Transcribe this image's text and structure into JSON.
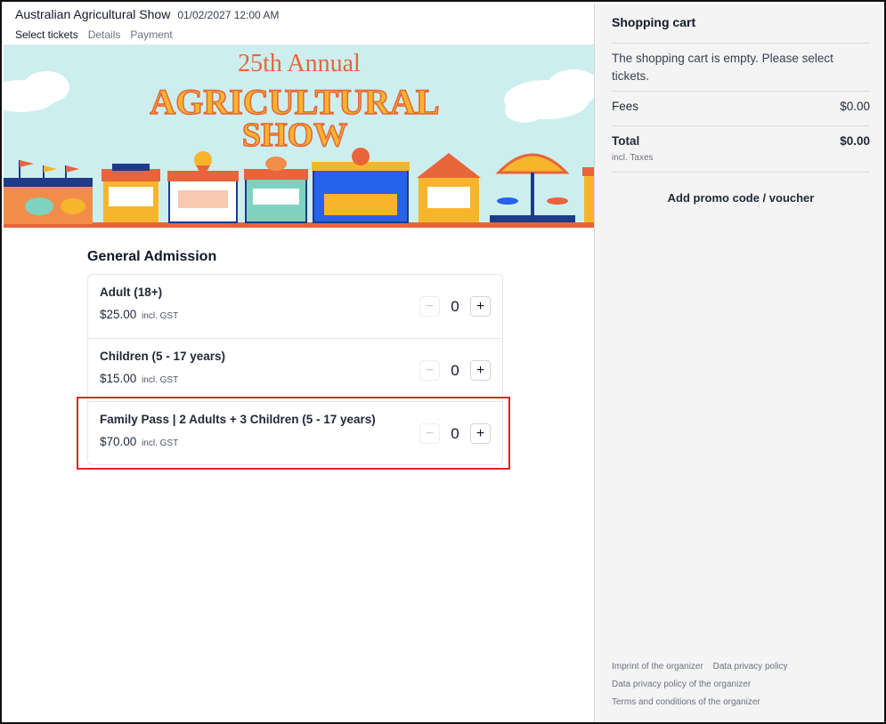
{
  "event": {
    "title": "Australian Agricultural Show",
    "date": "01/02/2027 12:00 AM"
  },
  "steps": [
    "Select tickets",
    "Details",
    "Payment"
  ],
  "banner": {
    "line1": "25th Annual",
    "line2": "AGRICULTURAL",
    "line3": "SHOW",
    "colors": {
      "sky": "#cdeeee",
      "orange": "#e8643a",
      "yellow": "#f7b52c",
      "navy": "#1e3a8a"
    }
  },
  "admission": {
    "title": "General Admission",
    "tickets": [
      {
        "name": "Adult (18+)",
        "price": "$25.00",
        "tax": "incl. GST",
        "qty": "0",
        "minus": "−",
        "plus": "+"
      },
      {
        "name": "Children (5 - 17 years)",
        "price": "$15.00",
        "tax": "incl. GST",
        "qty": "0",
        "minus": "−",
        "plus": "+"
      },
      {
        "name": "Family Pass | 2 Adults + 3 Children (5 - 17 years)",
        "price": "$70.00",
        "tax": "incl. GST",
        "qty": "0",
        "minus": "−",
        "plus": "+"
      }
    ]
  },
  "cart": {
    "title": "Shopping cart",
    "empty_message": "The shopping cart is empty. Please select tickets.",
    "fees_label": "Fees",
    "fees_value": "$0.00",
    "total_label": "Total",
    "total_value": "$0.00",
    "incl_taxes": "incl. Taxes",
    "promo": "Add promo code / voucher"
  },
  "footer": {
    "imprint": "Imprint of the organizer",
    "privacy": "Data privacy policy",
    "privacy_org": "Data privacy policy of the organizer",
    "terms": "Terms and conditions of the organizer"
  },
  "colors": {
    "highlight": "#dc2626",
    "sidebar_bg": "#f4f4f4"
  }
}
